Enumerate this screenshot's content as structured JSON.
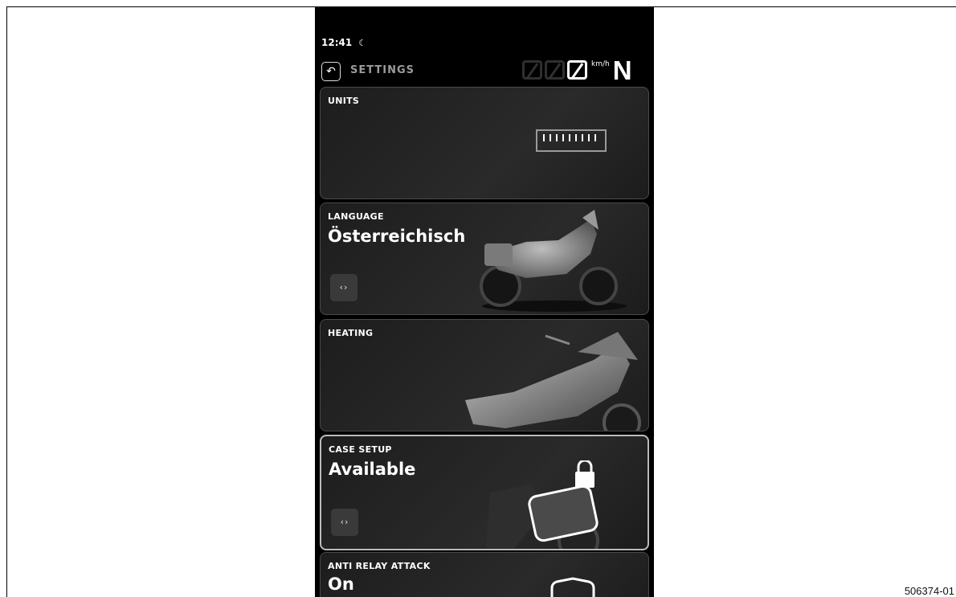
{
  "status": {
    "time": "12:41",
    "night_mode_icon": "moon-icon"
  },
  "header": {
    "back_icon": "back-arrow-icon",
    "title": "SETTINGS"
  },
  "speedometer": {
    "value": "0",
    "unit": "km/h",
    "gear": "N"
  },
  "cards": [
    {
      "label": "UNITS",
      "value": "",
      "icon": "ruler-icon"
    },
    {
      "label": "LANGUAGE",
      "value": "Österreichisch",
      "nav_label": "‹›",
      "image": "motorcycle-image"
    },
    {
      "label": "HEATING",
      "value": "",
      "image": "motorcycle-image"
    },
    {
      "label": "CASE SETUP",
      "value": "Available",
      "nav_label": "‹›",
      "image": "case-lock-image",
      "selected": true
    },
    {
      "label": "ANTI RELAY ATTACK",
      "value": "On",
      "image": "shield-image"
    }
  ],
  "figure_id": "506374-01",
  "colors": {
    "background": "#000000",
    "card": "#242424",
    "text": "#ffffff",
    "muted": "#9a9a9a"
  }
}
